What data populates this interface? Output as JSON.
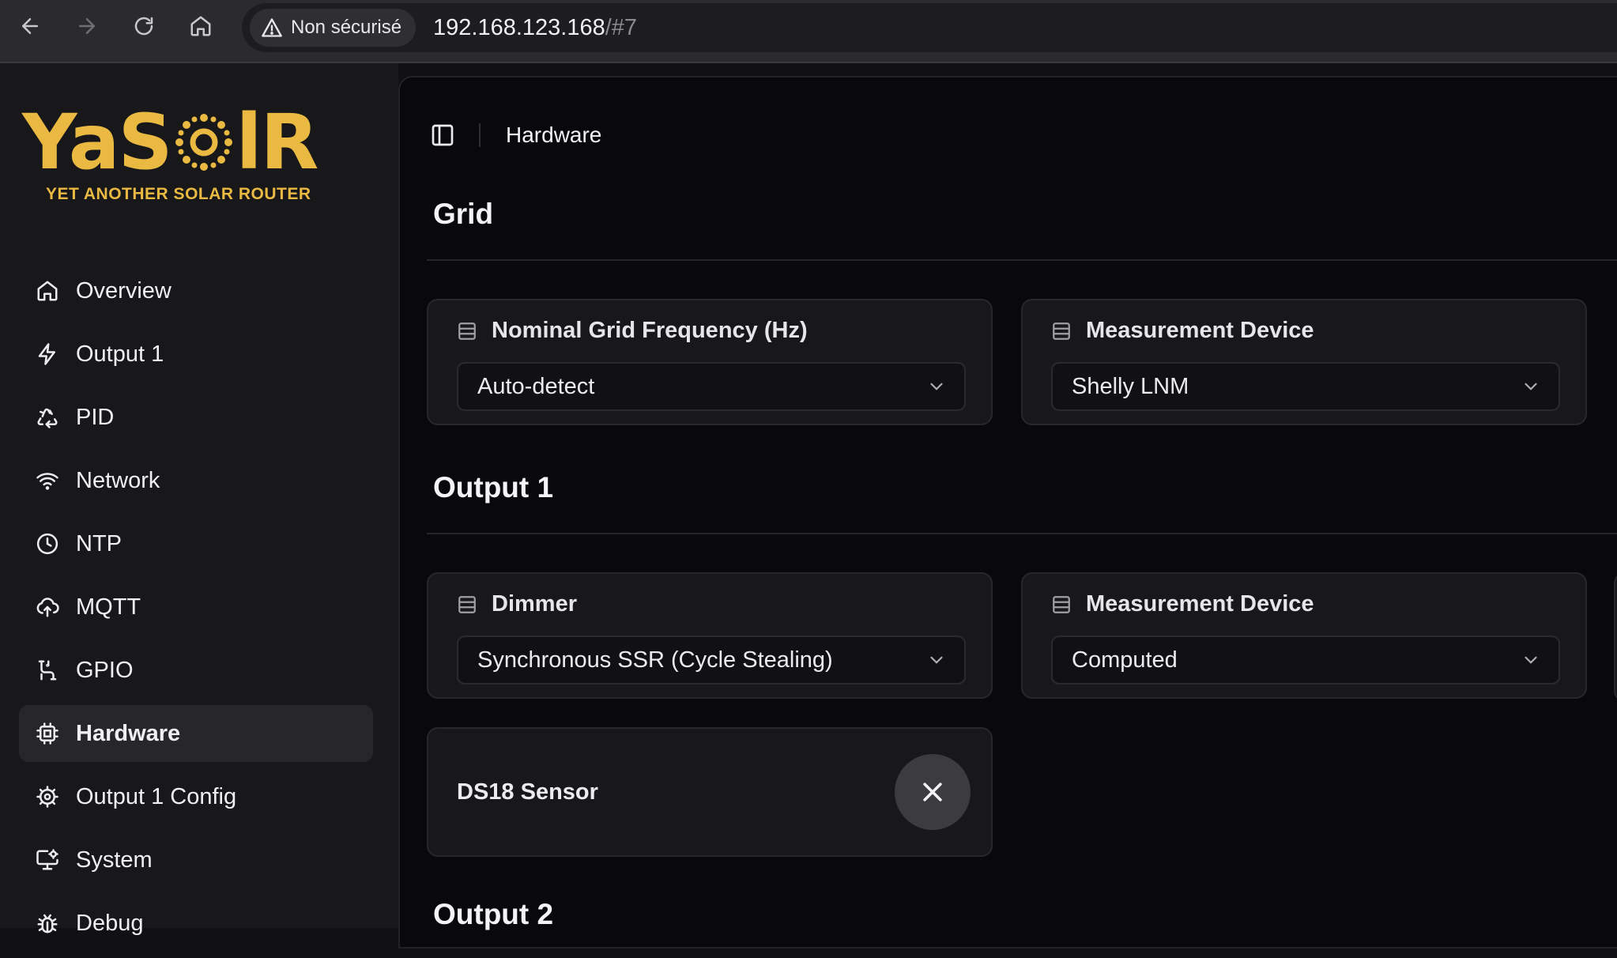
{
  "browser": {
    "security_label": "Non sécurisé",
    "url_host": "192.168.123.168",
    "url_fragment": "/#7"
  },
  "logo": {
    "text_a": "YaS",
    "text_b": "lR",
    "tagline": "YET ANOTHER SOLAR ROUTER",
    "color": "#e9b941"
  },
  "sidebar": {
    "items": [
      {
        "label": "Overview",
        "icon": "home-icon"
      },
      {
        "label": "Output 1",
        "icon": "zap-icon"
      },
      {
        "label": "PID",
        "icon": "recycle-icon"
      },
      {
        "label": "Network",
        "icon": "wifi-icon"
      },
      {
        "label": "NTP",
        "icon": "clock-icon"
      },
      {
        "label": "MQTT",
        "icon": "cloud-upload-icon"
      },
      {
        "label": "GPIO",
        "icon": "route-icon"
      },
      {
        "label": "Hardware",
        "icon": "cpu-icon",
        "active": true
      },
      {
        "label": "Output 1 Config",
        "icon": "cog-icon"
      },
      {
        "label": "System",
        "icon": "monitor-cog-icon"
      },
      {
        "label": "Debug",
        "icon": "bug-icon"
      }
    ]
  },
  "header": {
    "breadcrumb": "Hardware"
  },
  "sections": {
    "grid": {
      "title": "Grid",
      "frequency_label": "Nominal Grid Frequency (Hz)",
      "frequency_value": "Auto-detect",
      "measurement_label": "Measurement Device",
      "measurement_value": "Shelly LNM"
    },
    "output1": {
      "title": "Output 1",
      "dimmer_label": "Dimmer",
      "dimmer_value": "Synchronous SSR (Cycle Stealing)",
      "measurement_label": "Measurement Device",
      "measurement_value": "Computed",
      "sensor_label": "DS18 Sensor"
    },
    "output2": {
      "title": "Output 2"
    }
  }
}
